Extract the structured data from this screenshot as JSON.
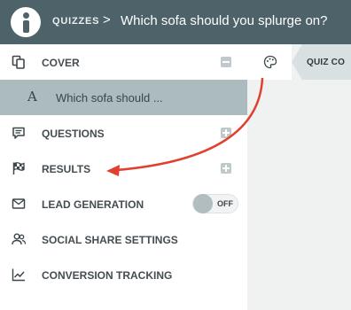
{
  "header": {
    "breadcrumb_root": "QUIZZES",
    "separator": ">",
    "title": "Which sofa should you splurge on?"
  },
  "sidebar": {
    "items": [
      {
        "label": "COVER",
        "icon": "copy-icon",
        "action": "collapse"
      },
      {
        "label": "Which sofa should ...",
        "icon": "text-letter-icon",
        "selected": true
      },
      {
        "label": "QUESTIONS",
        "icon": "comment-icon",
        "action": "add"
      },
      {
        "label": "RESULTS",
        "icon": "checkered-flag-icon",
        "action": "add"
      },
      {
        "label": "LEAD GENERATION",
        "icon": "envelope-icon",
        "toggle": "OFF"
      },
      {
        "label": "SOCIAL SHARE SETTINGS",
        "icon": "users-icon"
      },
      {
        "label": "CONVERSION TRACKING",
        "icon": "trend-chart-icon"
      }
    ]
  },
  "main": {
    "tab_icon": "palette-icon",
    "tab_label": "QUIZ CO"
  },
  "colors": {
    "header_bg": "#4e6269",
    "selected_bg": "#acbbbd",
    "arrow": "#e0402c"
  }
}
